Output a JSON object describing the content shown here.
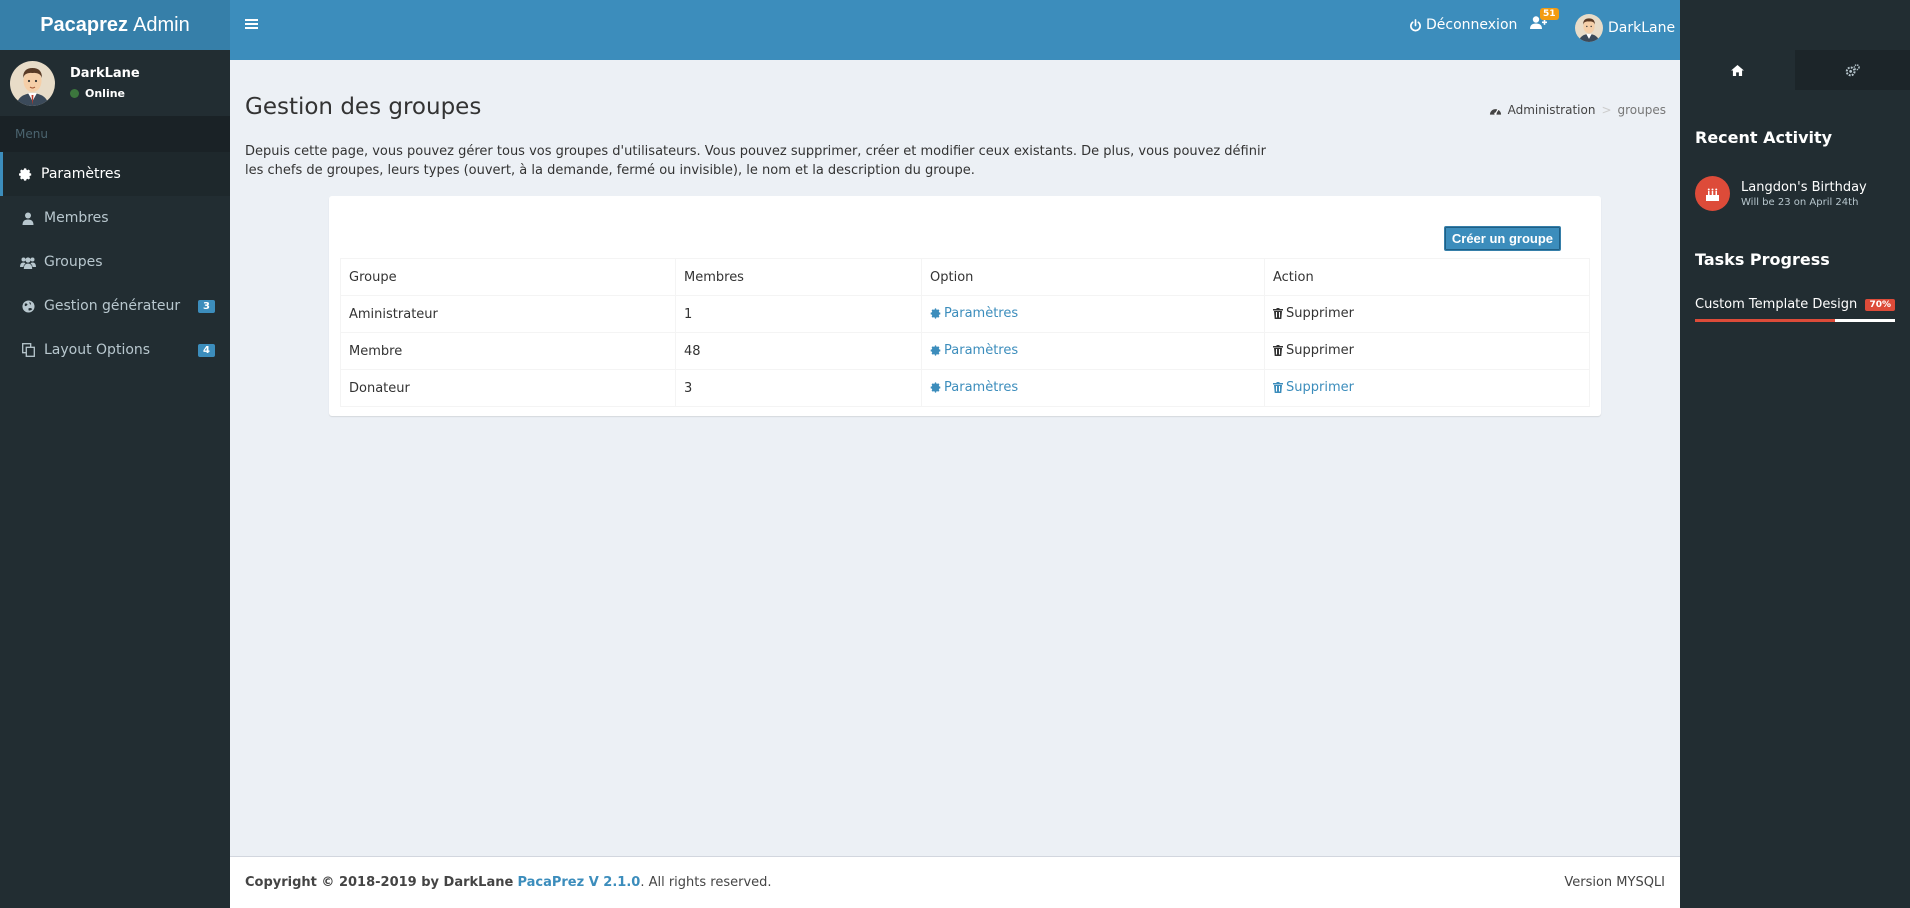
{
  "app": {
    "logo_bold": "Pacaprez",
    "logo_light": "Admin"
  },
  "user": {
    "name": "DarkLane",
    "status": "Online"
  },
  "sidebar": {
    "header": "Menu",
    "items": [
      {
        "label": "Paramètres",
        "icon": "gear-icon",
        "active": true
      },
      {
        "label": "Membres",
        "icon": "user-icon"
      },
      {
        "label": "Groupes",
        "icon": "users-icon"
      },
      {
        "label": "Gestion générateur",
        "icon": "globe-icon",
        "badge": "3"
      },
      {
        "label": "Layout Options",
        "icon": "copy-icon",
        "badge": "4"
      }
    ]
  },
  "topbar": {
    "logout_label": "Déconnexion",
    "notification_count": "51",
    "user_name": "DarkLane"
  },
  "page": {
    "title": "Gestion des groupes",
    "breadcrumb": [
      "Administration",
      "groupes"
    ],
    "description": "Depuis cette page, vous pouvez gérer tous vos groupes d'utilisateurs. Vous pouvez supprimer, créer et modifier ceux existants. De plus, vous pouvez définir les chefs de groupes, leurs types (ouvert, à la demande, fermé ou invisible), le nom et la description du groupe.",
    "create_button": "Créer un groupe"
  },
  "table": {
    "headers": [
      "Groupe",
      "Membres",
      "Option",
      "Action"
    ],
    "rows": [
      {
        "group": "Aministrateur",
        "members": "1",
        "option": "Paramètres",
        "action": "Supprimer"
      },
      {
        "group": "Membre",
        "members": "48",
        "option": "Paramètres",
        "action": "Supprimer"
      },
      {
        "group": "Donateur",
        "members": "3",
        "option": "Paramètres",
        "action": "Supprimer"
      }
    ]
  },
  "footer": {
    "copyright": "Copyright © 2018-2019 by DarkLane",
    "product_link": "PacaPrez V 2.1.0",
    "rights": ". All rights reserved.",
    "version": "Version MYSQLI"
  },
  "control_sidebar": {
    "recent_activity_heading": "Recent Activity",
    "activity": {
      "title": "Langdon's Birthday",
      "subtitle": "Will be 23 on April 24th",
      "icon": "birthday-cake-icon"
    },
    "tasks_heading": "Tasks Progress",
    "task": {
      "label": "Custom Template Design",
      "badge": "70%",
      "progress": 0.7
    }
  },
  "colors": {
    "primary": "#3c8dbc",
    "sidebar_bg": "#222d32",
    "danger": "#dd4b39",
    "warning": "#f39c12"
  }
}
